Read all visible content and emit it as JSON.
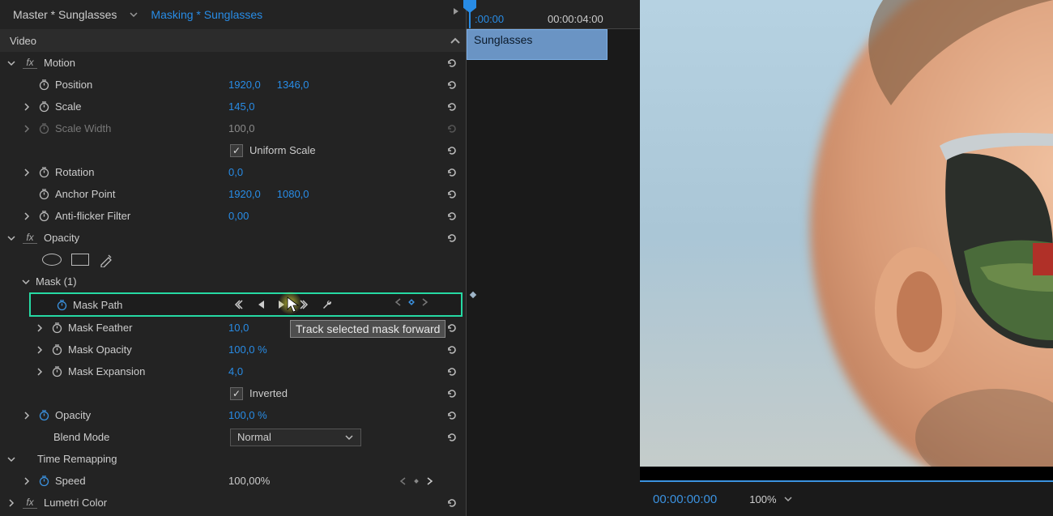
{
  "tabs": {
    "master": "Master * Sunglasses",
    "masking": "Masking * Sunglasses"
  },
  "video_header": "Video",
  "motion": {
    "title": "Motion",
    "position": {
      "label": "Position",
      "x": "1920,0",
      "y": "1346,0"
    },
    "scale": {
      "label": "Scale",
      "v": "145,0"
    },
    "scale_width": {
      "label": "Scale Width",
      "v": "100,0"
    },
    "uniform_scale": {
      "label": "Uniform Scale",
      "checked": true
    },
    "rotation": {
      "label": "Rotation",
      "v": "0,0"
    },
    "anchor": {
      "label": "Anchor Point",
      "x": "1920,0",
      "y": "1080,0"
    },
    "anti_flicker": {
      "label": "Anti-flicker Filter",
      "v": "0,00"
    }
  },
  "opacity": {
    "title": "Opacity",
    "mask": {
      "title": "Mask (1)",
      "path": {
        "label": "Mask Path"
      },
      "feather": {
        "label": "Mask Feather",
        "v": "10,0"
      },
      "opacity": {
        "label": "Mask Opacity",
        "v": "100,0 %"
      },
      "expansion": {
        "label": "Mask Expansion",
        "v": "4,0"
      },
      "inverted": {
        "label": "Inverted",
        "checked": true
      }
    },
    "opacity_prop": {
      "label": "Opacity",
      "v": "100,0 %"
    },
    "blend": {
      "label": "Blend Mode",
      "v": "Normal"
    }
  },
  "time_remap": {
    "title": "Time Remapping",
    "speed": {
      "label": "Speed",
      "v": "100,00%"
    }
  },
  "lumetri": {
    "title": "Lumetri Color"
  },
  "timeline": {
    "tick_start": ":00:00",
    "tick_end": "00:00:04:00",
    "clip_name": "Sunglasses"
  },
  "tooltip": "Track selected mask forward",
  "footer": {
    "timecode": "00:00:00:00",
    "zoom": "100%"
  }
}
